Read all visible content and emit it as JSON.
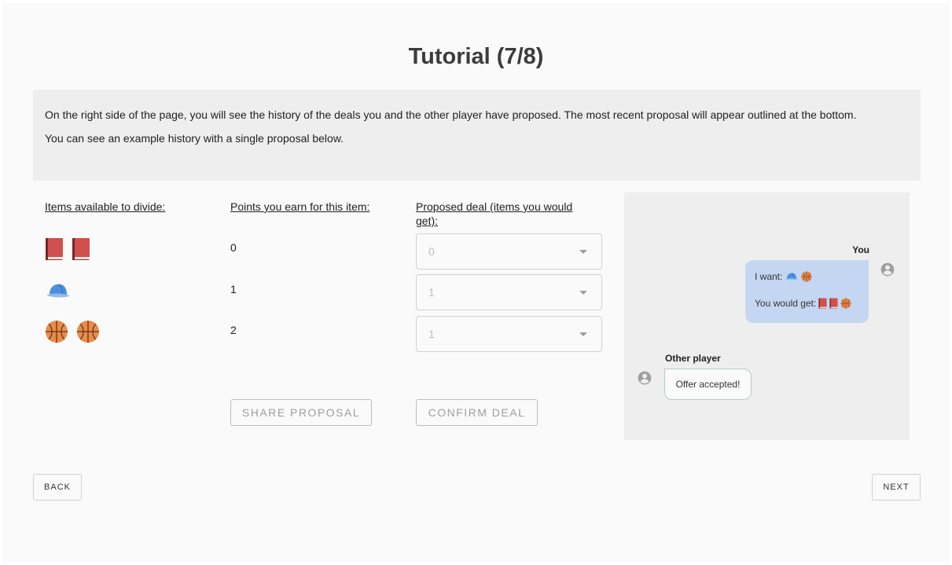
{
  "title": "Tutorial (7/8)",
  "instructions": {
    "p1": "On the right side of the page, you will see the history of the deals you and the other player have proposed. The most recent proposal will appear outlined at the bottom.",
    "p2": "You can see an example history with a single proposal below."
  },
  "columns": {
    "items": "Items available to divide:",
    "points": "Points you earn for this item:",
    "deal": "Proposed deal (items you would get):"
  },
  "rows": [
    {
      "item": "book",
      "count": 2,
      "points": "0",
      "deal": "0"
    },
    {
      "item": "hat",
      "count": 1,
      "points": "1",
      "deal": "1"
    },
    {
      "item": "ball",
      "count": 2,
      "points": "2",
      "deal": "1"
    }
  ],
  "buttons": {
    "share": "Share proposal",
    "confirm": "Confirm deal",
    "back": "BACK",
    "next": "NEXT"
  },
  "chat": {
    "you_label": "You",
    "you_want": "I want:",
    "you_would_get": "You would get:",
    "other_label": "Other player",
    "other_message": "Offer accepted!"
  },
  "icons": {
    "book": "book-icon",
    "hat": "cap-icon",
    "ball": "basketball-icon",
    "avatar": "person-icon"
  },
  "colors": {
    "you_bubble": "#c5d6f2",
    "chat_bg": "#eeeeee",
    "book": "#c94747",
    "ball": "#e88c4a",
    "cap": "#4a8fe0"
  }
}
